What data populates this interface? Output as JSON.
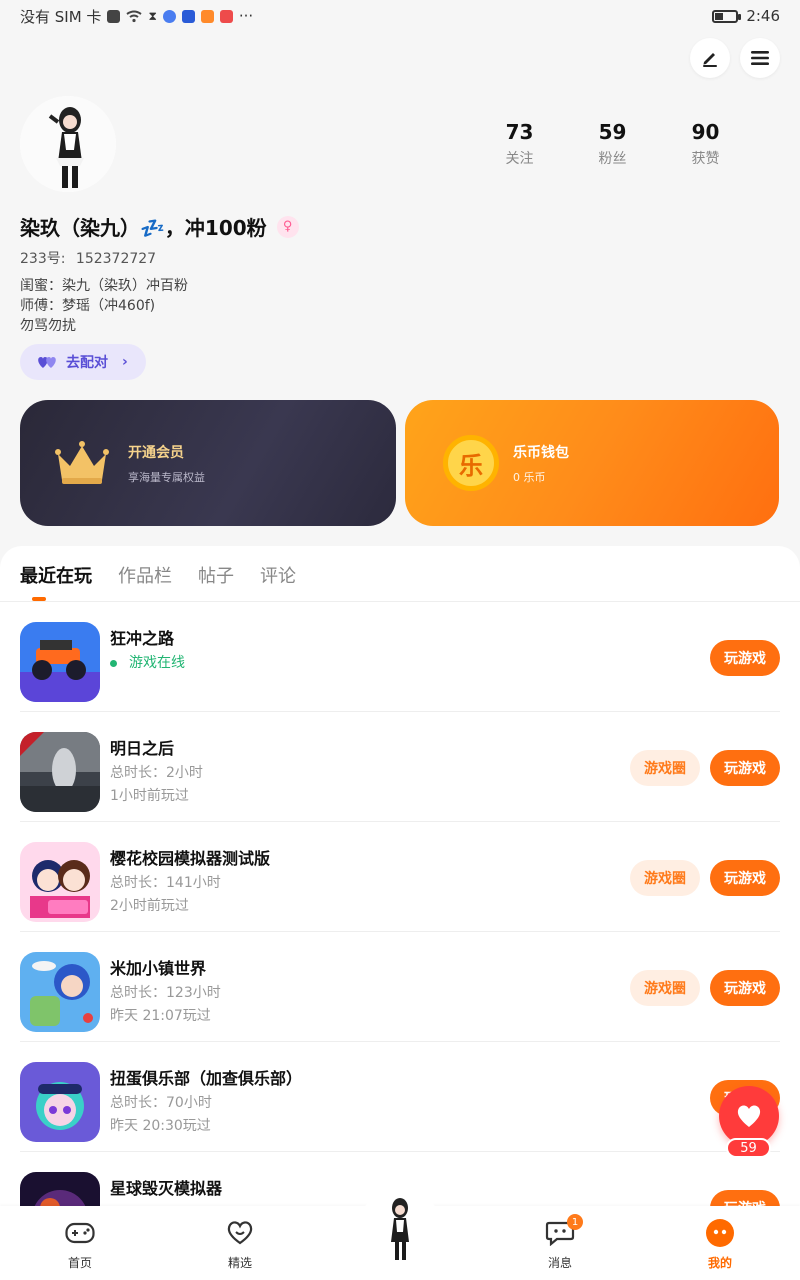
{
  "status_bar": {
    "carrier": "没有 SIM 卡",
    "time": "2:46"
  },
  "profile": {
    "stats": [
      {
        "value": "73",
        "label": "关注"
      },
      {
        "value": "59",
        "label": "粉丝"
      },
      {
        "value": "90",
        "label": "获赞"
      }
    ],
    "nickname": "染玖（染九）💤，冲100粉",
    "gender_symbol": "♀",
    "uid_label": "233号:",
    "uid_value": "152372727",
    "bio_lines": [
      "闺蜜：染九（染玖）冲百粉",
      "师傅：梦瑶（冲460f)",
      "勿骂勿扰"
    ],
    "pair_button": "去配对"
  },
  "cards": {
    "vip": {
      "title": "开通会员",
      "subtitle": "享海量专属权益"
    },
    "wallet": {
      "title": "乐币钱包",
      "subtitle": "0 乐币",
      "coin_glyph": "乐"
    }
  },
  "tabs": [
    "最近在玩",
    "作品栏",
    "帖子",
    "评论"
  ],
  "games": [
    {
      "name": "狂冲之路",
      "line2": "游戏在线",
      "line3": "",
      "online": true,
      "show_circle": false
    },
    {
      "name": "明日之后",
      "line2": "总时长：2小时",
      "line3": "1小时前玩过",
      "online": false,
      "show_circle": true
    },
    {
      "name": "樱花校园模拟器测试版",
      "line2": "总时长：141小时",
      "line3": "2小时前玩过",
      "online": false,
      "show_circle": true
    },
    {
      "name": "米加小镇世界",
      "line2": "总时长：123小时",
      "line3": "昨天 21:07玩过",
      "online": false,
      "show_circle": true
    },
    {
      "name": "扭蛋俱乐部（加查俱乐部）",
      "line2": "总时长：70小时",
      "line3": "昨天 20:30玩过",
      "online": false,
      "show_circle": false
    },
    {
      "name": "星球毁灭模拟器",
      "line2": "",
      "line3": "",
      "online": false,
      "show_circle": false
    }
  ],
  "buttons": {
    "play": "玩游戏",
    "circle": "游戏圈"
  },
  "float_like_count": "59",
  "bottom_nav": {
    "home": "首页",
    "featured": "精选",
    "messages": "消息",
    "messages_badge": "1",
    "mine": "我的"
  },
  "colors": {
    "accent": "#ff6f10",
    "online": "#22b573",
    "like": "#ff3b3b"
  }
}
